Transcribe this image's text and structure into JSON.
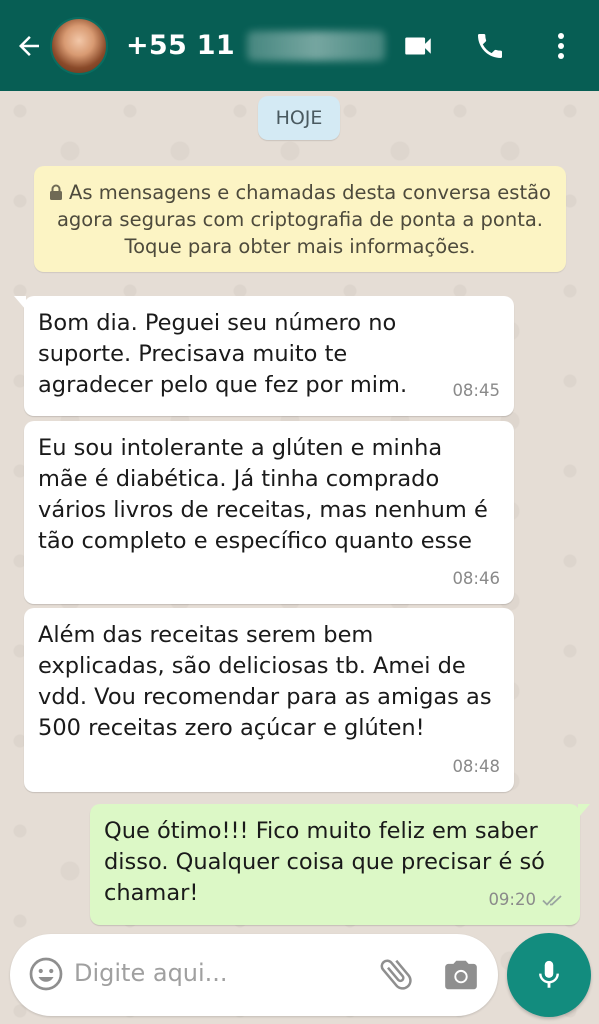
{
  "header": {
    "contact_prefix": "+55 11",
    "accent": "#075e54"
  },
  "chat": {
    "date_label": "HOJE",
    "encryption_notice": "As mensagens e chamadas desta conversa estão agora seguras com criptografia de ponta a ponta. Toque para obter mais informações.",
    "messages": [
      {
        "direction": "in",
        "text": "Bom dia. Peguei seu número no suporte. Precisava muito te agradecer pelo que fez por mim.",
        "time": "08:45"
      },
      {
        "direction": "in",
        "text": "Eu sou intolerante a glúten e minha mãe é diabética. Já tinha comprado vários livros de receitas, mas nenhum é tão completo e específico quanto esse",
        "time": "08:46"
      },
      {
        "direction": "in",
        "text": "Além das receitas serem bem explicadas, são deliciosas tb. Amei de vdd. Vou recomendar para as amigas as 500  receitas zero açúcar e glúten!",
        "time": "08:48"
      },
      {
        "direction": "out",
        "text": "Que ótimo!!! Fico muito feliz em saber disso. Qualquer coisa que precisar é só chamar!",
        "time": "09:20",
        "status": "read-ticks-icon"
      }
    ]
  },
  "composer": {
    "placeholder": "Digite aqui...",
    "icons": [
      "emoji-icon",
      "attach-icon",
      "camera-icon",
      "mic-icon"
    ],
    "mic_color": "#128c7e"
  }
}
